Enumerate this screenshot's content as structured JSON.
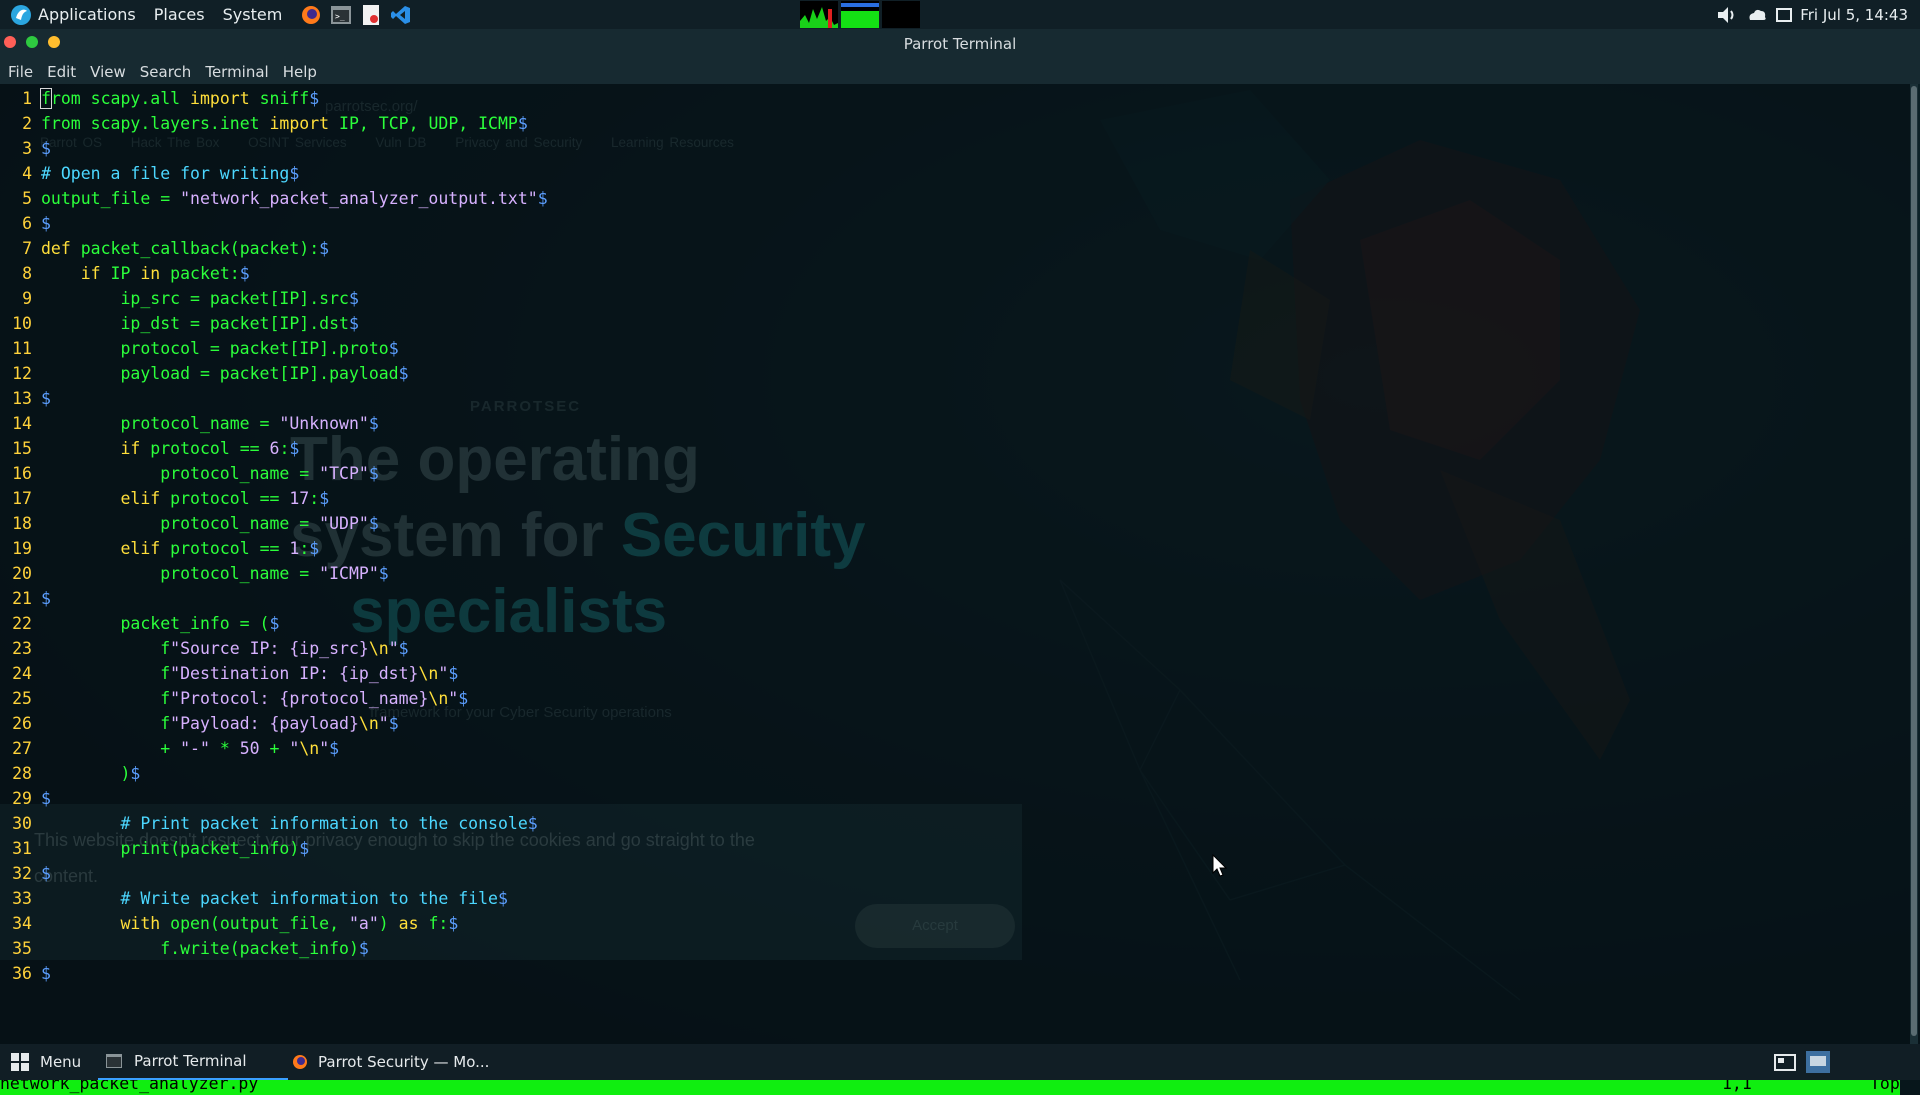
{
  "top_panel": {
    "applications_label": "Applications",
    "places_label": "Places",
    "system_label": "System",
    "clock": "Fri Jul 5, 14:43"
  },
  "terminal": {
    "title": "Parrot Terminal",
    "menu": [
      "File",
      "Edit",
      "View",
      "Search",
      "Terminal",
      "Help"
    ],
    "status": {
      "filename": "network_packet_analyzer.py",
      "position": "1,1",
      "scroll": "Top"
    },
    "lines": [
      {
        "n": "1",
        "segs": [
          {
            "t": "f",
            "c": "id",
            "cursor": true
          },
          {
            "t": "rom",
            "c": "id"
          },
          {
            "t": " scapy.all ",
            "c": "id"
          },
          {
            "t": "import",
            "c": "kw"
          },
          {
            "t": " sniff",
            "c": "id"
          },
          {
            "t": "$",
            "c": "eol"
          }
        ]
      },
      {
        "n": "2",
        "segs": [
          {
            "t": "from",
            "c": "id"
          },
          {
            "t": " scapy.layers.inet ",
            "c": "id"
          },
          {
            "t": "import",
            "c": "kw"
          },
          {
            "t": " IP, TCP, UDP, ICMP",
            "c": "id"
          },
          {
            "t": "$",
            "c": "eol"
          }
        ]
      },
      {
        "n": "3",
        "segs": [
          {
            "t": "$",
            "c": "eol"
          }
        ]
      },
      {
        "n": "4",
        "segs": [
          {
            "t": "# Open a file for writing",
            "c": "cm"
          },
          {
            "t": "$",
            "c": "eol"
          }
        ]
      },
      {
        "n": "5",
        "segs": [
          {
            "t": "output_file = ",
            "c": "id"
          },
          {
            "t": "\"network_packet_analyzer_output.txt\"",
            "c": "st"
          },
          {
            "t": "$",
            "c": "eol"
          }
        ]
      },
      {
        "n": "6",
        "segs": [
          {
            "t": "$",
            "c": "eol"
          }
        ]
      },
      {
        "n": "7",
        "segs": [
          {
            "t": "def",
            "c": "kw"
          },
          {
            "t": " packet_callback(packet):",
            "c": "id"
          },
          {
            "t": "$",
            "c": "eol"
          }
        ]
      },
      {
        "n": "8",
        "segs": [
          {
            "t": "    ",
            "c": "id"
          },
          {
            "t": "if",
            "c": "kw"
          },
          {
            "t": " IP ",
            "c": "id"
          },
          {
            "t": "in",
            "c": "kw"
          },
          {
            "t": " packet:",
            "c": "id"
          },
          {
            "t": "$",
            "c": "eol"
          }
        ]
      },
      {
        "n": "9",
        "segs": [
          {
            "t": "        ip_src = packet[IP].src",
            "c": "id"
          },
          {
            "t": "$",
            "c": "eol"
          }
        ]
      },
      {
        "n": "10",
        "segs": [
          {
            "t": "        ip_dst = packet[IP].dst",
            "c": "id"
          },
          {
            "t": "$",
            "c": "eol"
          }
        ]
      },
      {
        "n": "11",
        "segs": [
          {
            "t": "        protocol = packet[IP].proto",
            "c": "id"
          },
          {
            "t": "$",
            "c": "eol"
          }
        ]
      },
      {
        "n": "12",
        "segs": [
          {
            "t": "        payload = packet[IP].payload",
            "c": "id"
          },
          {
            "t": "$",
            "c": "eol"
          }
        ]
      },
      {
        "n": "13",
        "segs": [
          {
            "t": "$",
            "c": "eol"
          }
        ]
      },
      {
        "n": "14",
        "segs": [
          {
            "t": "        protocol_name = ",
            "c": "id"
          },
          {
            "t": "\"Unknown\"",
            "c": "st"
          },
          {
            "t": "$",
            "c": "eol"
          }
        ]
      },
      {
        "n": "15",
        "segs": [
          {
            "t": "        ",
            "c": "id"
          },
          {
            "t": "if",
            "c": "kw"
          },
          {
            "t": " protocol == ",
            "c": "id"
          },
          {
            "t": "6",
            "c": "st"
          },
          {
            "t": ":",
            "c": "id"
          },
          {
            "t": "$",
            "c": "eol"
          }
        ]
      },
      {
        "n": "16",
        "segs": [
          {
            "t": "            protocol_name = ",
            "c": "id"
          },
          {
            "t": "\"TCP\"",
            "c": "st"
          },
          {
            "t": "$",
            "c": "eol"
          }
        ]
      },
      {
        "n": "17",
        "segs": [
          {
            "t": "        ",
            "c": "id"
          },
          {
            "t": "elif",
            "c": "kw"
          },
          {
            "t": " protocol == ",
            "c": "id"
          },
          {
            "t": "17",
            "c": "st"
          },
          {
            "t": ":",
            "c": "id"
          },
          {
            "t": "$",
            "c": "eol"
          }
        ]
      },
      {
        "n": "18",
        "segs": [
          {
            "t": "            protocol_name = ",
            "c": "id"
          },
          {
            "t": "\"UDP\"",
            "c": "st"
          },
          {
            "t": "$",
            "c": "eol"
          }
        ]
      },
      {
        "n": "19",
        "segs": [
          {
            "t": "        ",
            "c": "id"
          },
          {
            "t": "elif",
            "c": "kw"
          },
          {
            "t": " protocol == ",
            "c": "id"
          },
          {
            "t": "1",
            "c": "st"
          },
          {
            "t": ":",
            "c": "id"
          },
          {
            "t": "$",
            "c": "eol"
          }
        ]
      },
      {
        "n": "20",
        "segs": [
          {
            "t": "            protocol_name = ",
            "c": "id"
          },
          {
            "t": "\"ICMP\"",
            "c": "st"
          },
          {
            "t": "$",
            "c": "eol"
          }
        ]
      },
      {
        "n": "21",
        "segs": [
          {
            "t": "$",
            "c": "eol"
          }
        ]
      },
      {
        "n": "22",
        "segs": [
          {
            "t": "        packet_info = (",
            "c": "id"
          },
          {
            "t": "$",
            "c": "eol"
          }
        ]
      },
      {
        "n": "23",
        "segs": [
          {
            "t": "            f",
            "c": "id"
          },
          {
            "t": "\"Source IP: {ip_src}",
            "c": "st"
          },
          {
            "t": "\\n",
            "c": "kw"
          },
          {
            "t": "\"",
            "c": "st"
          },
          {
            "t": "$",
            "c": "eol"
          }
        ]
      },
      {
        "n": "24",
        "segs": [
          {
            "t": "            f",
            "c": "id"
          },
          {
            "t": "\"Destination IP: {ip_dst}",
            "c": "st"
          },
          {
            "t": "\\n",
            "c": "kw"
          },
          {
            "t": "\"",
            "c": "st"
          },
          {
            "t": "$",
            "c": "eol"
          }
        ]
      },
      {
        "n": "25",
        "segs": [
          {
            "t": "            f",
            "c": "id"
          },
          {
            "t": "\"Protocol: {protocol_name}",
            "c": "st"
          },
          {
            "t": "\\n",
            "c": "kw"
          },
          {
            "t": "\"",
            "c": "st"
          },
          {
            "t": "$",
            "c": "eol"
          }
        ]
      },
      {
        "n": "26",
        "segs": [
          {
            "t": "            f",
            "c": "id"
          },
          {
            "t": "\"Payload: {payload}",
            "c": "st"
          },
          {
            "t": "\\n",
            "c": "kw"
          },
          {
            "t": "\"",
            "c": "st"
          },
          {
            "t": "$",
            "c": "eol"
          }
        ]
      },
      {
        "n": "27",
        "segs": [
          {
            "t": "            + ",
            "c": "id"
          },
          {
            "t": "\"-\"",
            "c": "st"
          },
          {
            "t": " * ",
            "c": "id"
          },
          {
            "t": "50",
            "c": "st"
          },
          {
            "t": " + ",
            "c": "id"
          },
          {
            "t": "\"",
            "c": "st"
          },
          {
            "t": "\\n",
            "c": "kw"
          },
          {
            "t": "\"",
            "c": "st"
          },
          {
            "t": "$",
            "c": "eol"
          }
        ]
      },
      {
        "n": "28",
        "segs": [
          {
            "t": "        )",
            "c": "id"
          },
          {
            "t": "$",
            "c": "eol"
          }
        ]
      },
      {
        "n": "29",
        "segs": [
          {
            "t": "$",
            "c": "eol"
          }
        ]
      },
      {
        "n": "30",
        "segs": [
          {
            "t": "        ",
            "c": "id"
          },
          {
            "t": "# Print packet information to the console",
            "c": "cm"
          },
          {
            "t": "$",
            "c": "eol"
          }
        ]
      },
      {
        "n": "31",
        "segs": [
          {
            "t": "        print(packet_info)",
            "c": "id"
          },
          {
            "t": "$",
            "c": "eol"
          }
        ]
      },
      {
        "n": "32",
        "segs": [
          {
            "t": "$",
            "c": "eol"
          }
        ]
      },
      {
        "n": "33",
        "segs": [
          {
            "t": "        ",
            "c": "id"
          },
          {
            "t": "# Write packet information to the file",
            "c": "cm"
          },
          {
            "t": "$",
            "c": "eol"
          }
        ]
      },
      {
        "n": "34",
        "segs": [
          {
            "t": "        ",
            "c": "id"
          },
          {
            "t": "with",
            "c": "kw"
          },
          {
            "t": " open(output_file, ",
            "c": "id"
          },
          {
            "t": "\"a\"",
            "c": "st"
          },
          {
            "t": ") ",
            "c": "id"
          },
          {
            "t": "as",
            "c": "kw"
          },
          {
            "t": " f:",
            "c": "id"
          },
          {
            "t": "$",
            "c": "eol"
          }
        ]
      },
      {
        "n": "35",
        "segs": [
          {
            "t": "            f.write(packet_info)",
            "c": "id"
          },
          {
            "t": "$",
            "c": "eol"
          }
        ]
      },
      {
        "n": "36",
        "segs": [
          {
            "t": "$",
            "c": "eol"
          }
        ]
      }
    ]
  },
  "background_browser": {
    "url": "parrotsec.org/",
    "bookmarks": [
      "Parrot OS",
      "Hack The Box",
      "OSINT Services",
      "Vuln DB",
      "Privacy and Security",
      "Learning Resources"
    ],
    "brand": "PARROTSEC",
    "hero_line1": "The operating",
    "hero_line2a": "system for ",
    "hero_line2b": "Security",
    "hero_line3": "specialists",
    "subtitle": "framework for your Cyber Security operations",
    "cookie_line1": "This website doesn't respect your privacy enough to skip the cookies and go straight to the",
    "cookie_line2": "content.",
    "accept_label": "Accept"
  },
  "taskbar": {
    "menu_label": "Menu",
    "tasks": [
      "Parrot Terminal",
      "Parrot Security — Mo..."
    ]
  },
  "colors": {
    "status_bar": "#10ee10",
    "line_number": "#ffd23b",
    "identifier": "#2bff3b",
    "keyword": "#ffdf3b",
    "string": "#d7b1ff",
    "comment": "#4cd7ff"
  }
}
